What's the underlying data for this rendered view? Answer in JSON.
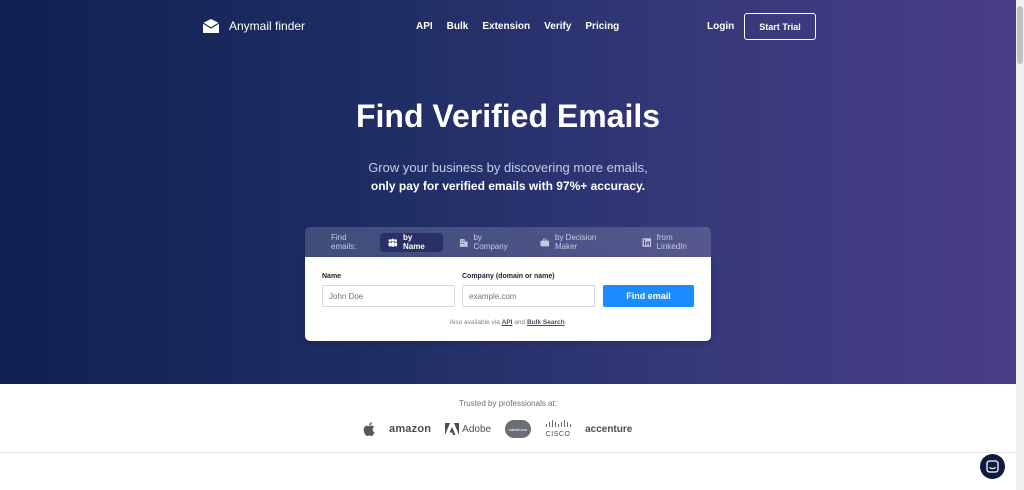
{
  "nav": {
    "brand": "Anymail finder",
    "links": [
      "API",
      "Bulk",
      "Extension",
      "Verify",
      "Pricing"
    ],
    "login": "Login",
    "start_trial": "Start Trial"
  },
  "hero": {
    "title": "Find Verified Emails",
    "subtitle_line1": "Grow your business by discovering more emails,",
    "subtitle_line2": "only pay for verified emails with 97%+ accuracy."
  },
  "search": {
    "tabs_label": "Find emails:",
    "tabs": [
      {
        "label": "by Name",
        "icon": "people-icon",
        "active": true
      },
      {
        "label": "by Company",
        "icon": "building-icon",
        "active": false
      },
      {
        "label": "by Decision Maker",
        "icon": "briefcase-icon",
        "active": false
      },
      {
        "label": "from LinkedIn",
        "icon": "linkedin-icon",
        "active": false
      }
    ],
    "name_label": "Name",
    "name_placeholder": "John Doe",
    "company_label": "Company (domain or name)",
    "company_placeholder": "example.com",
    "find_button": "Find email",
    "also_prefix": "Also available via",
    "also_api": "API",
    "also_and": "and",
    "also_bulk": "Bulk Search",
    "also_suffix": "."
  },
  "trusted": {
    "label": "Trusted by professionals at:",
    "logos": {
      "amazon": "amazon",
      "adobe": "Adobe",
      "salesforce": "salesforce",
      "cisco": "CISCO",
      "accenture": "accenture"
    }
  },
  "colors": {
    "hero_start": "#0f2150",
    "hero_end": "#4a3d88",
    "accent": "#1a8cff"
  }
}
